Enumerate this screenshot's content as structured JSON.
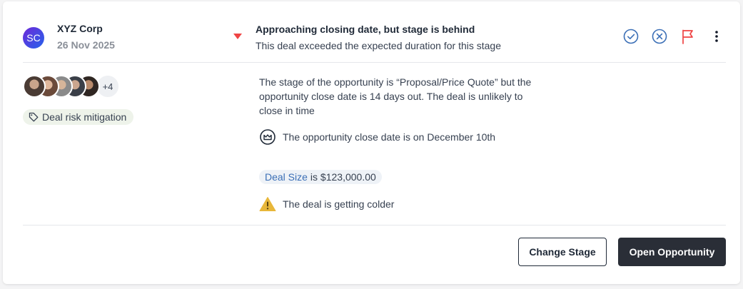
{
  "deal": {
    "avatar_initials": "SC",
    "company": "XYZ Corp",
    "date": "26 Nov 2025"
  },
  "alert": {
    "title": "Approaching closing date, but stage is behind",
    "subtitle": "This deal exceeded the expected duration for this stage"
  },
  "participants": {
    "extra_count": "+4"
  },
  "tag": {
    "label": "Deal risk mitigation"
  },
  "details": {
    "description": "The stage of the opportunity is “Proposal/Price Quote” but the opportunity close date is 14 days out. The deal is unlikely to close in time",
    "close_date_text": "The opportunity close date is on December 10th",
    "deal_size_label": "Deal Size",
    "deal_size_value": "is $123,000.00",
    "warning_text": "The deal is getting colder"
  },
  "actions": {
    "change_stage": "Change Stage",
    "open_opportunity": "Open Opportunity"
  },
  "colors": {
    "accent_blue": "#3b6fb6",
    "flag_red": "#ef4444",
    "warning_yellow": "#e8b73a",
    "dark_button": "#2a2e37"
  }
}
